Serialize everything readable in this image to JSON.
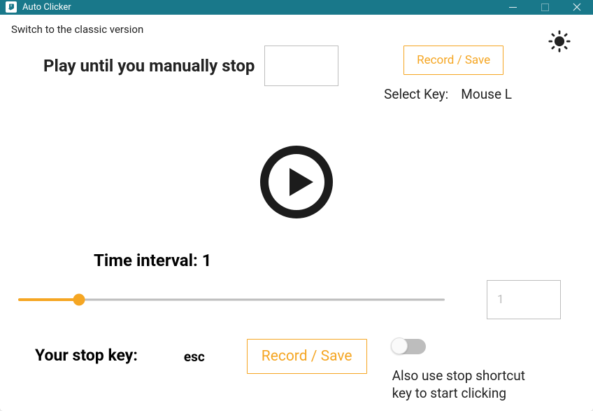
{
  "window": {
    "title": "Auto Clicker"
  },
  "top": {
    "switch_link": "Switch to the classic version"
  },
  "mode": {
    "play_until": "Play until you manually stop"
  },
  "record_save": "Record / Save",
  "select_key": {
    "label": "Select Key:",
    "value": "Mouse L"
  },
  "interval": {
    "label_prefix": "Time interval:",
    "value_label": "Time interval: 1",
    "input_value": "1",
    "slider_percent": 14.2
  },
  "stop": {
    "label": "Your stop key:",
    "value": "esc",
    "record_save": "Record / Save"
  },
  "also_use": {
    "text": "Also use stop shortcut key to start clicking",
    "enabled": false
  }
}
